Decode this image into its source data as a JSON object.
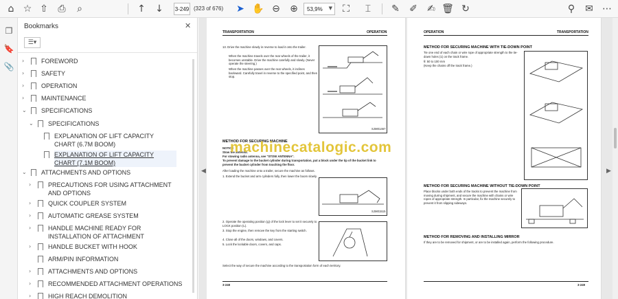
{
  "toolbar": {
    "icons": [
      "home-icon",
      "star-icon",
      "upload-icon",
      "print-icon",
      "zoom-search-icon",
      "page-up-icon",
      "page-down-icon",
      "select-cursor-icon",
      "hand-icon",
      "zoom-out-icon",
      "zoom-in-icon",
      "fit-page-icon",
      "text-select-icon",
      "comment-icon",
      "highlight-icon",
      "delete-icon",
      "rotate-icon",
      "link-icon",
      "email-icon",
      "more-icon"
    ],
    "page_number": "3-249",
    "page_count": "(323 of 676)",
    "zoom": "53,9%"
  },
  "sidebar": {
    "title": "Bookmarks",
    "items": [
      {
        "label": "FOREWORD",
        "expanded": false
      },
      {
        "label": "SAFETY",
        "expanded": false
      },
      {
        "label": "OPERATION",
        "expanded": false
      },
      {
        "label": "MAINTENANCE",
        "expanded": false
      },
      {
        "label": "SPECIFICATIONS",
        "expanded": true
      },
      {
        "label": "SPECIFICATIONS",
        "expanded": true
      },
      {
        "label": "EXPLANATION OF LIFT CAPACITY CHART (6.7M BOOM)"
      },
      {
        "label": "EXPLANATION OF LIFT CAPACITY CHART (7.1M BOOM)"
      },
      {
        "label": "ATTACHMENTS AND OPTIONS",
        "expanded": true
      },
      {
        "label": "PRECAUTIONS FOR USING ATTACHMENT AND OPTIONS",
        "expanded": false
      },
      {
        "label": "QUICK COUPLER SYSTEM",
        "expanded": false
      },
      {
        "label": "AUTOMATIC GREASE SYSTEM",
        "expanded": false
      },
      {
        "label": "HANDLE MACHINE READY FOR INSTALLATION OF ATTACHMENT",
        "expanded": false
      },
      {
        "label": "HANDLE BUCKET WITH HOOK",
        "expanded": false
      },
      {
        "label": "ARM/PIN INFORMATION"
      },
      {
        "label": "ATTACHMENTS AND OPTIONS",
        "expanded": false
      },
      {
        "label": "RECOMMENDED ATTACHMENT OPERATIONS",
        "expanded": false
      },
      {
        "label": "HIGH REACH DEMOLITION",
        "expanded": false
      }
    ]
  },
  "left_page": {
    "header_left": "TRANSPORTATION",
    "header_right": "OPERATION",
    "step13": "13. Drive the machine slowly in reverse to load it onto the trailer.",
    "p1": "When the machine travels over the rear wheels of the trailer, it becomes unstable. Drive the machine carefully and slowly. (Never operate the steering.)",
    "p2": "When the machine passes over the rear wheels, it inclines backward. Carefully travel in reverse to the specified point, and then stop.",
    "fig1_code": "SJM01467",
    "section": "METHOD FOR SECURING MACHINE",
    "notice": "NOTICE",
    "notice1": "Stow the antenna.",
    "notice2": "For stowing radio antenna, see \"STOW ANTENNA\".",
    "notice3": "To prevent damage to the bucket cylinder during transportation, put a block under the tip of the bucket link to prevent the bucket cylinder from touching the floor.",
    "after": "After loading the machine onto a trailer, secure the machine as follows.",
    "step1": "1. Extend the bucket and arm cylinders fully, then lower the boom slowly.",
    "fig2_code": "SJM01515",
    "step2": "2. Operate the operating position (g) of the lock lever to set it securely to LOCK position (L).",
    "step3": "3. Stop the engine, then remove the key from the starting switch.",
    "step4": "4. Close all of the doors, windows, and covers.",
    "step5": "5. Lock the lockable doors, covers, and caps.",
    "closing": "Select the way of secure the machine according to the transportation form of each territory.",
    "footer": "3-248"
  },
  "right_page": {
    "header_left": "OPERATION",
    "header_right": "TRANSPORTATION",
    "section1": "METHOD FOR SECURING MACHINE WITH TIE-DOWN POINT",
    "s1_text": "Tie one end of each chain or wire rope of appropriate strength to the tie-down holes (1) on the track frame.",
    "s1_angle": "θ: 50 to 100 mm",
    "s1_note": "(Keep the chains off the track frame.)",
    "section2": "METHOD FOR SECURING MACHINE WITHOUT TIE-DOWN POINT",
    "s2_text": "Place blocks under both ends of the tracks to prevent the machine from moving during shipment, and secure the machine with chains or wire ropes of appropriate strength. In particular, fix the machine securely to prevent it from slipping sideways.",
    "section3": "METHOD FOR REMOVING AND INSTALLING MIRROR",
    "s3_text": "If they are to be removed for shipment, or are to be installed again, perform the following procedure.",
    "footer": "3-249"
  },
  "watermark": "machinecatalogic.com"
}
